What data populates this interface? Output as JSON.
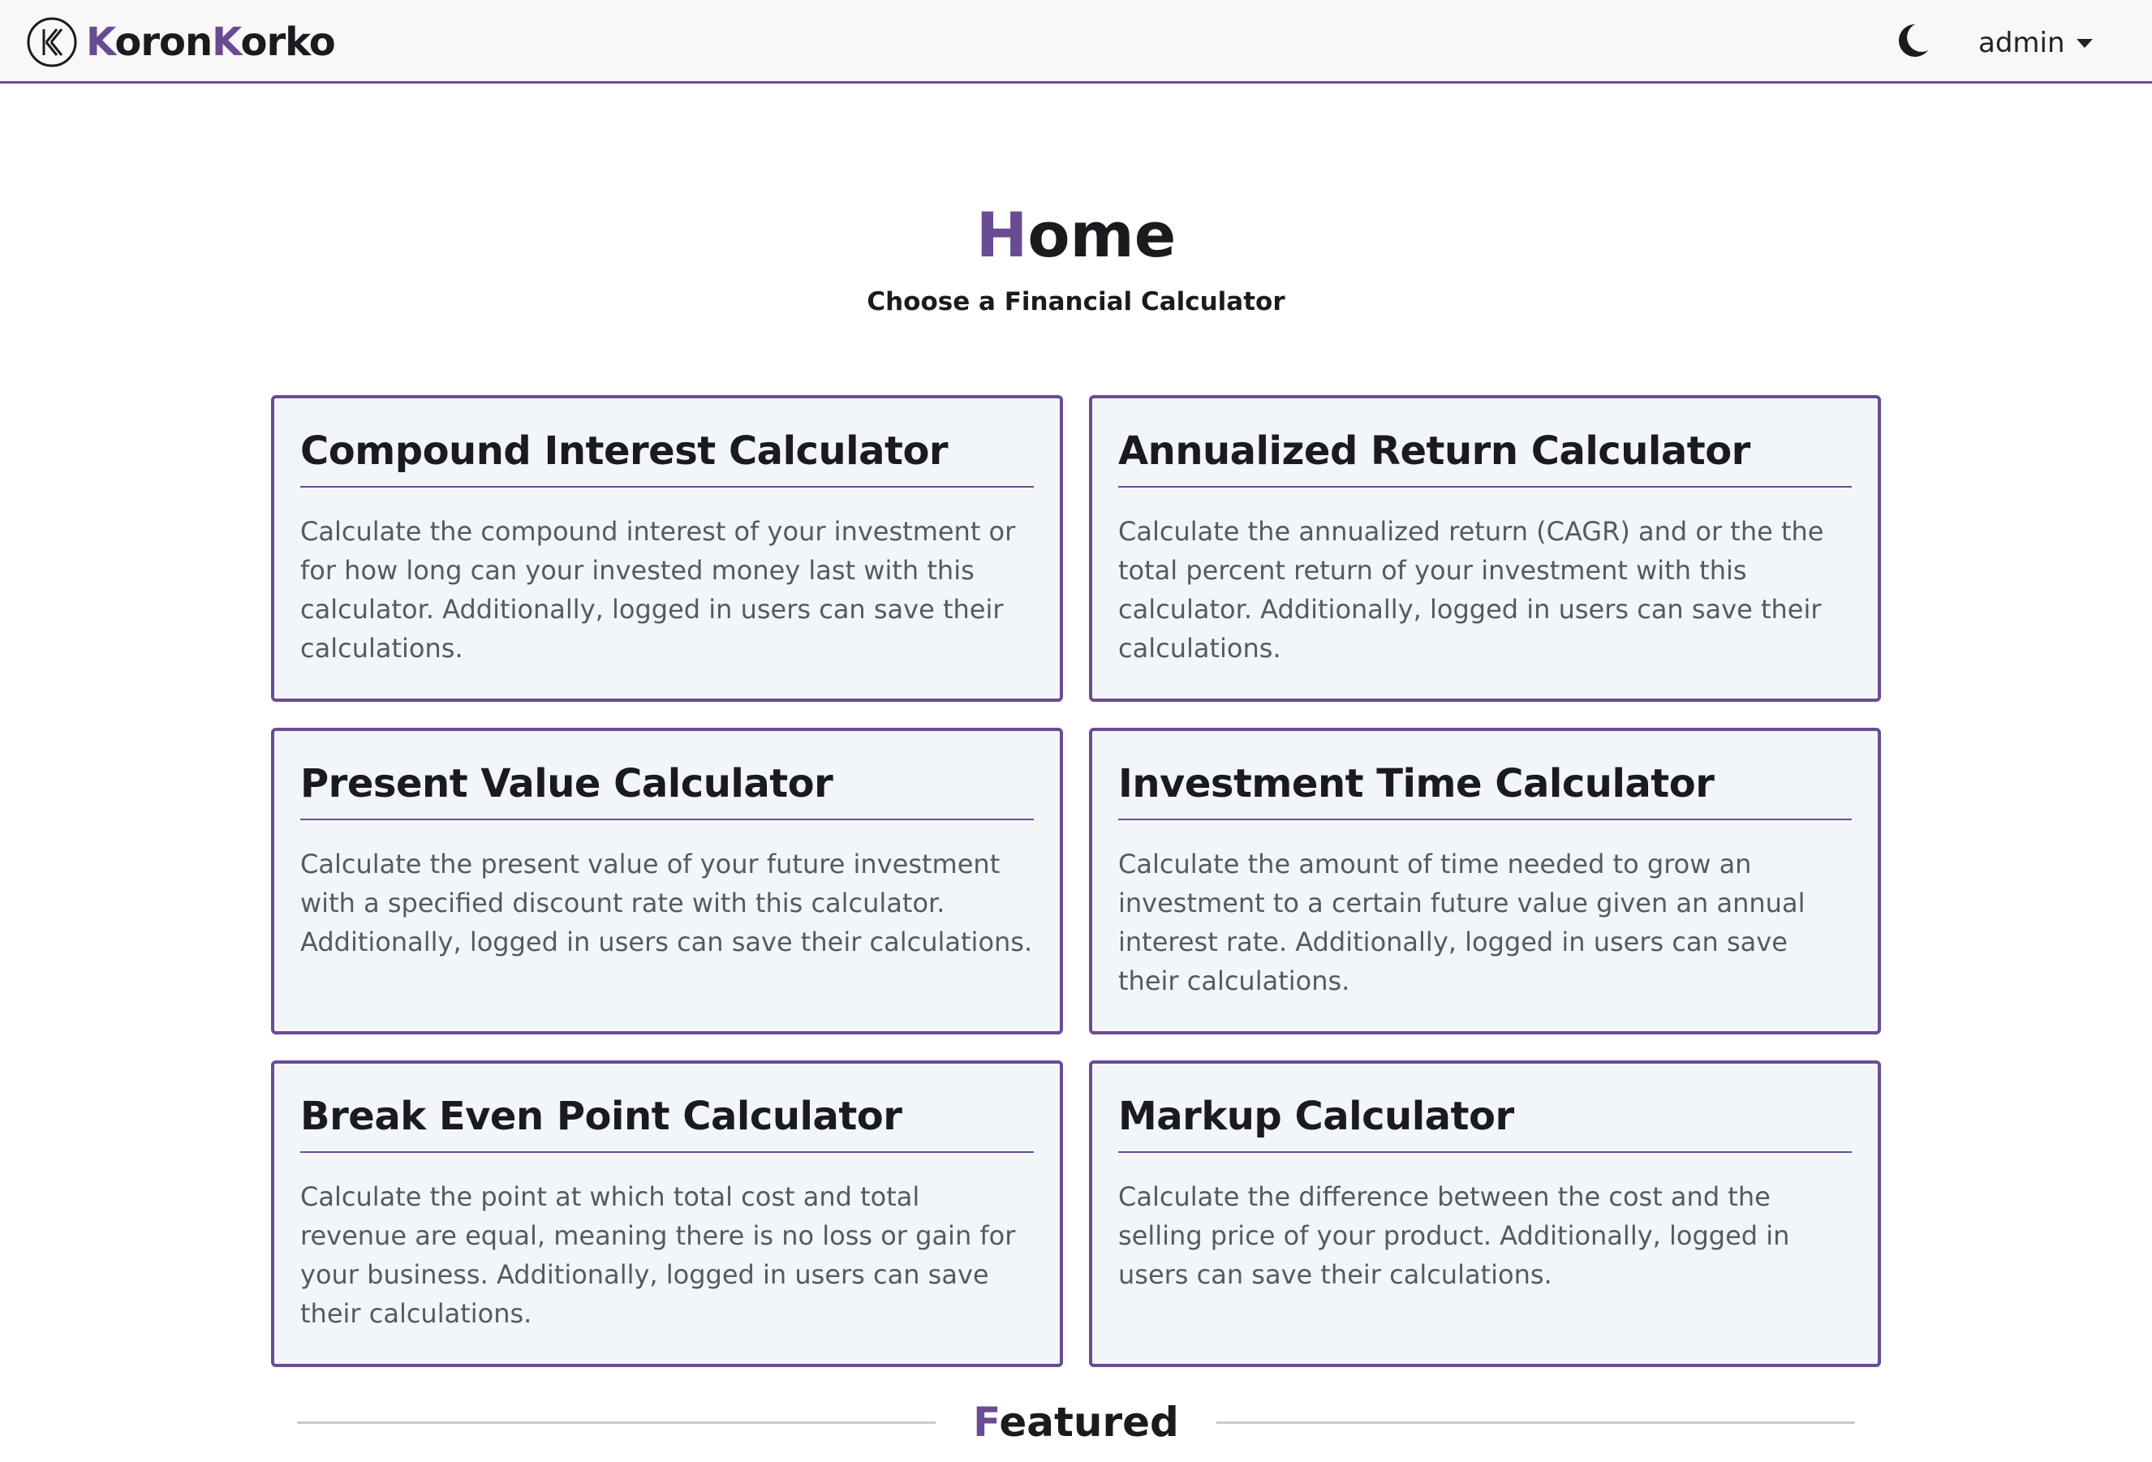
{
  "navbar": {
    "brand": {
      "first_initial": "K",
      "first_rest": "oron",
      "second_initial": "K",
      "second_rest": "orko"
    },
    "theme_toggle_icon": "moon-icon",
    "user_label": "admin",
    "user_caret_icon": "caret-down-icon"
  },
  "header": {
    "title_initial": "H",
    "title_rest": "ome",
    "subtitle": "Choose a Financial Calculator"
  },
  "calculators": [
    {
      "title": "Compound Interest Calculator",
      "description": "Calculate the compound interest of your investment or for how long can your invested money last with this calculator. Additionally, logged in users can save their calculations."
    },
    {
      "title": "Annualized Return Calculator",
      "description": "Calculate the annualized return (CAGR) and or the the total percent return of your investment with this calculator. Additionally, logged in users can save their calculations."
    },
    {
      "title": "Present Value Calculator",
      "description": "Calculate the present value of your future investment with a specified discount rate with this calculator. Additionally, logged in users can save their calculations."
    },
    {
      "title": "Investment Time Calculator",
      "description": "Calculate the amount of time needed to grow an investment to a certain future value given an annual interest rate. Additionally, logged in users can save their calculations."
    },
    {
      "title": "Break Even Point Calculator",
      "description": "Calculate the point at which total cost and total revenue are equal, meaning there is no loss or gain for your business. Additionally, logged in users can save their calculations."
    },
    {
      "title": "Markup Calculator",
      "description": "Calculate the difference between the cost and the selling price of your product. Additionally, logged in users can save their calculations."
    }
  ],
  "featured": {
    "title_initial": "F",
    "title_rest": "eatured"
  },
  "colors": {
    "accent": "#6a4c93",
    "card_background": "#f3f6f9",
    "navbar_background": "#f8f8f9",
    "divider": "#c9c9cc"
  }
}
